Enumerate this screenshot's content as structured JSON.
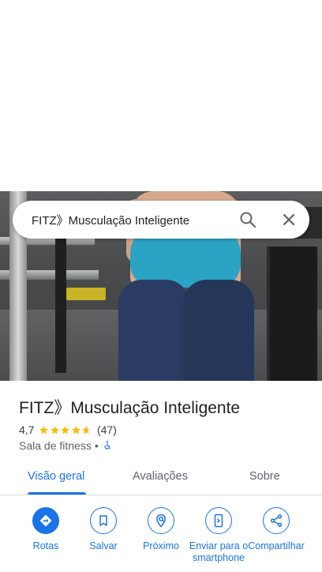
{
  "search": {
    "query": "FITZ》Musculação Inteligente"
  },
  "place": {
    "title": "FITZ》Musculação Inteligente",
    "rating": "4,7",
    "rating_value": 4.7,
    "review_count": "(47)",
    "category": "Sala de fitness",
    "separator": "•"
  },
  "tabs": [
    {
      "label": "Visão geral",
      "active": true
    },
    {
      "label": "Avaliações",
      "active": false
    },
    {
      "label": "Sobre",
      "active": false
    }
  ],
  "actions": [
    {
      "label": "Rotas",
      "icon": "directions-icon"
    },
    {
      "label": "Salvar",
      "icon": "bookmark-icon"
    },
    {
      "label": "Próximo",
      "icon": "nearby-icon"
    },
    {
      "label": "Enviar para o smartphone",
      "icon": "send-to-phone-icon"
    },
    {
      "label": "Compartilhar",
      "icon": "share-icon"
    }
  ],
  "colors": {
    "accent": "#1a73e8",
    "star": "#fbbc04",
    "text": "#202124",
    "muted": "#5f6368"
  }
}
